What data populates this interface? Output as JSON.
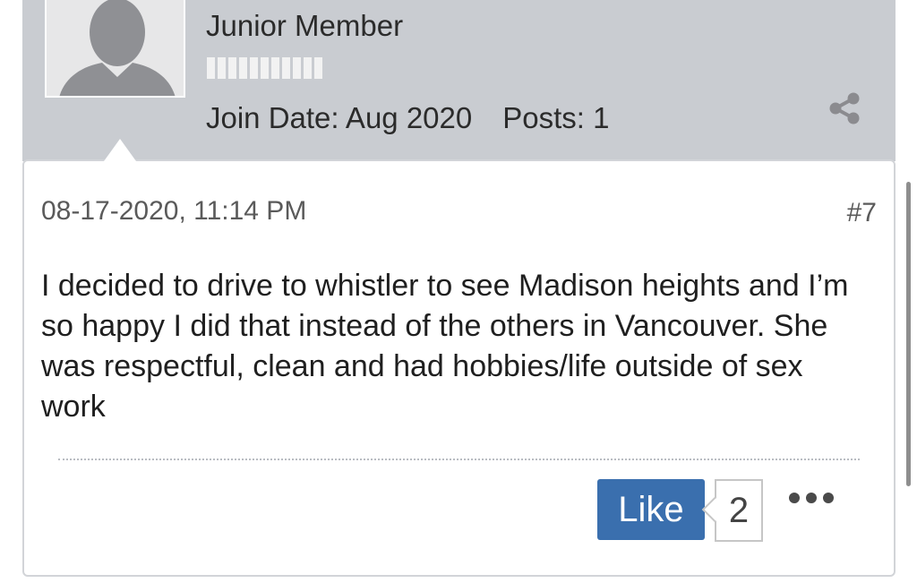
{
  "user": {
    "rank": "Junior Member",
    "reputation_segments": 11,
    "join_date": "Join Date: Aug 2020",
    "posts": "Posts: 1"
  },
  "post": {
    "date": "08-17-2020, 11:14 PM",
    "number": "#7",
    "body": "I decided to drive to whistler to see Madison heights and I’m so happy I did that instead of the others in Vancouver. She was respectful, clean and had hobbies/life outside of sex work"
  },
  "actions": {
    "like_label": "Like",
    "like_count": "2"
  },
  "icons": {
    "avatar": "default-user-avatar",
    "share": "share-icon",
    "more": "more-dots-icon"
  },
  "colors": {
    "header_band": "#c9ccd1",
    "like_button": "#3a6fae"
  }
}
